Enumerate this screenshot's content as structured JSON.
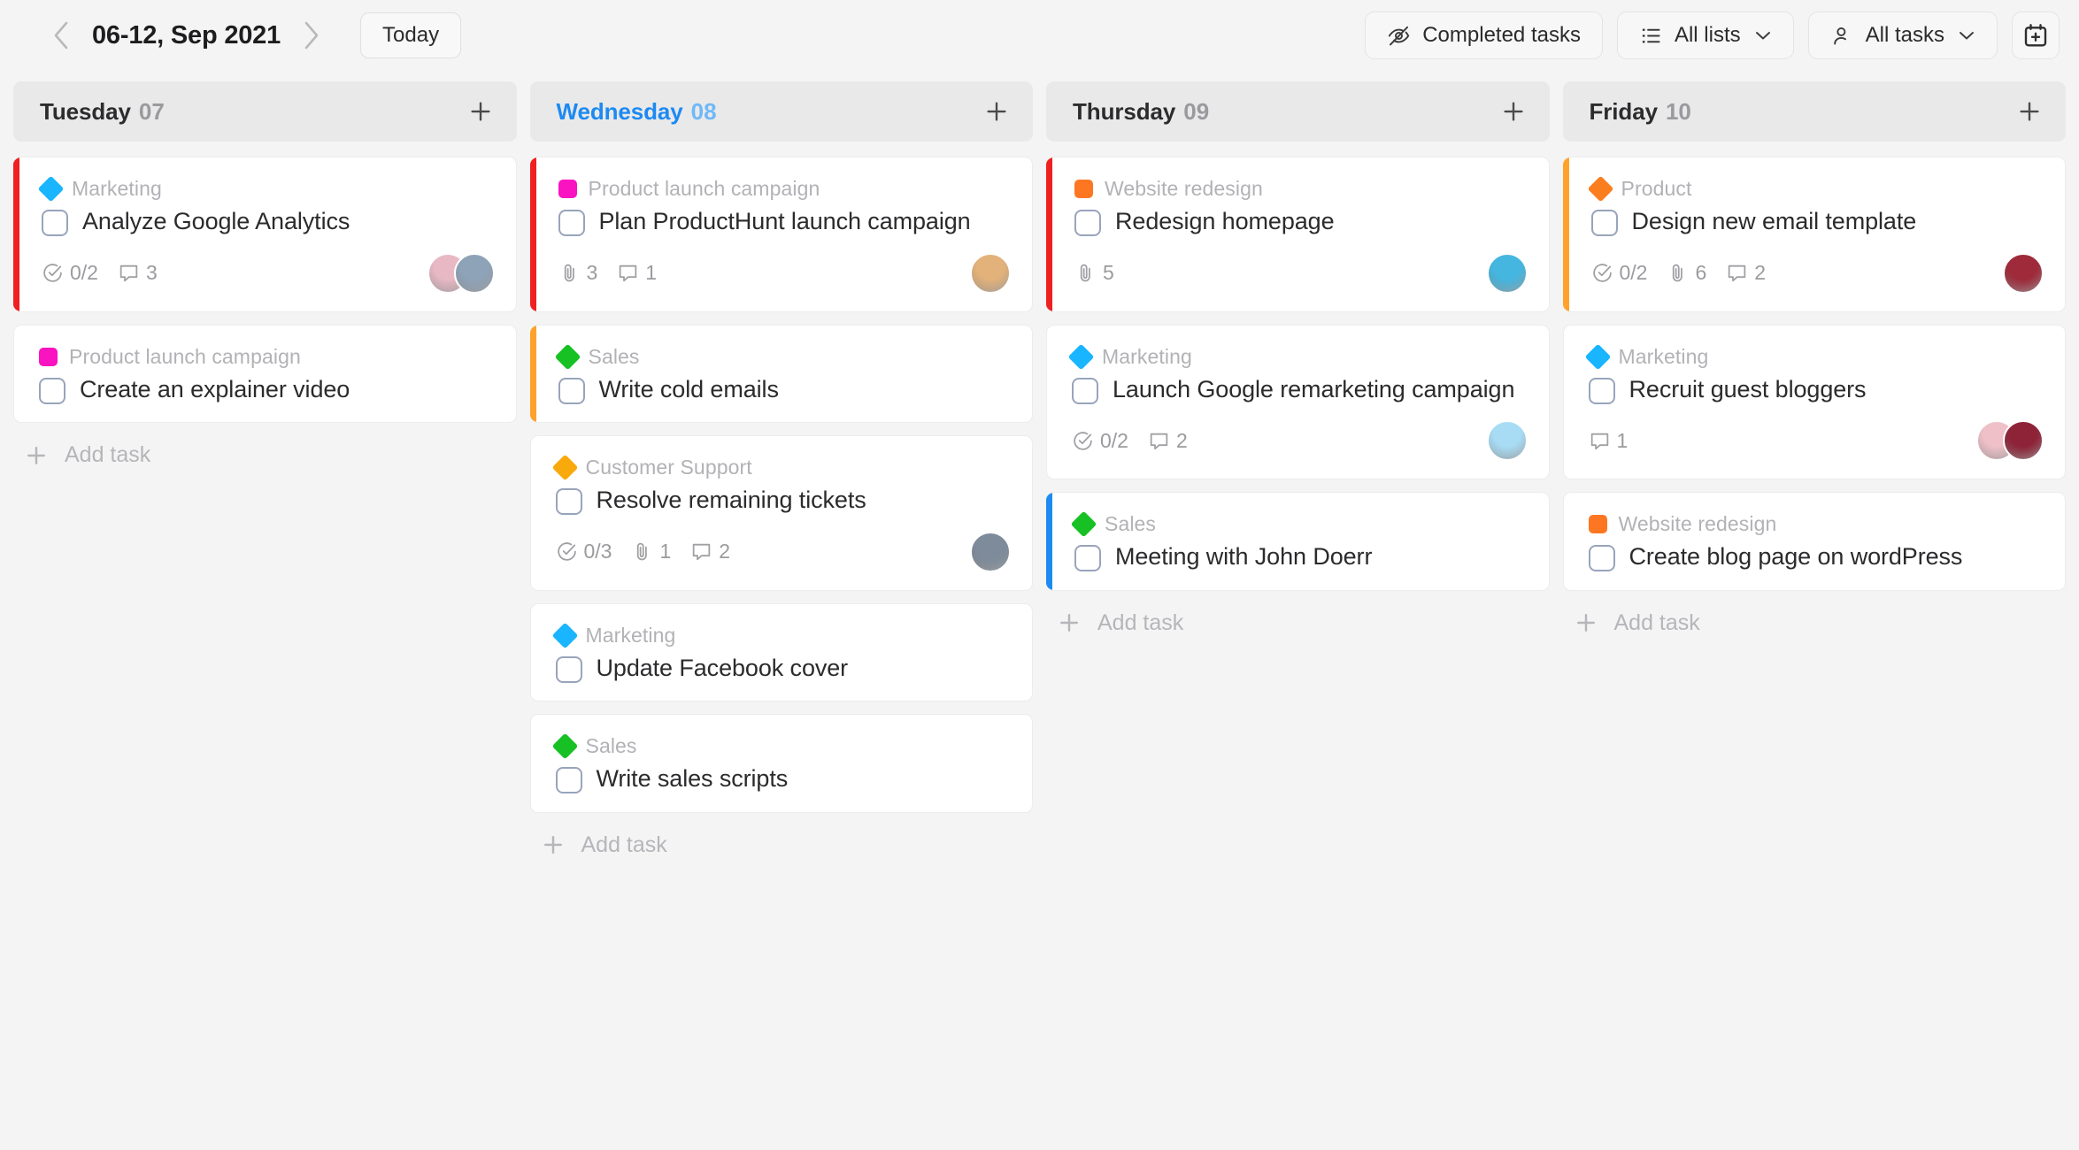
{
  "toolbar": {
    "prev_icon": "chevron-left-icon",
    "next_icon": "chevron-right-icon",
    "date_range": "06-12, Sep 2021",
    "today_label": "Today",
    "completed_tasks_label": "Completed tasks",
    "completed_tasks_icon": "eye-off-icon",
    "all_lists_label": "All lists",
    "all_lists_icon": "list-icon",
    "all_tasks_label": "All tasks",
    "all_tasks_icon": "person-icon",
    "caret_icon": "chevron-down-icon",
    "add_calendar_icon": "calendar-plus-icon"
  },
  "accent_colors": {
    "red": "#f02020",
    "orange": "#ffa22b",
    "blue": "#1d8af2",
    "today_blue": "#1d8af2"
  },
  "tag_colors": {
    "Marketing": "#19b5fe",
    "Product launch campaign": "#fa13c0",
    "Sales": "#17c123",
    "Customer Support": "#f8a90b",
    "Website redesign": "#fd7722",
    "Product": "#fb7e1e"
  },
  "add_task_label": "Add task",
  "add_task_icon": "plus-icon",
  "column_add_icon": "plus-icon",
  "columns": [
    {
      "day": "Tuesday",
      "date": "07",
      "is_today": false,
      "cards": [
        {
          "accent": "#f02020",
          "tag": "Marketing",
          "tag_shape": "diamond",
          "title": "Analyze Google Analytics",
          "meta": [
            {
              "icon": "subtasks-icon",
              "value": "0/2"
            },
            {
              "icon": "comment-icon",
              "value": "3"
            }
          ],
          "avatars": [
            "#e8b9c4",
            "#8fa3b8"
          ]
        },
        {
          "accent": null,
          "tag": "Product launch campaign",
          "tag_shape": "square",
          "title": "Create an explainer video",
          "meta": [],
          "avatars": []
        }
      ]
    },
    {
      "day": "Wednesday",
      "date": "08",
      "is_today": true,
      "cards": [
        {
          "accent": "#f02020",
          "tag": "Product launch campaign",
          "tag_shape": "square",
          "title": "Plan ProductHunt launch campaign",
          "meta": [
            {
              "icon": "attachment-icon",
              "value": "3"
            },
            {
              "icon": "comment-icon",
              "value": "1"
            }
          ],
          "avatars": [
            "#e3b27a"
          ]
        },
        {
          "accent": "#ffa22b",
          "tag": "Sales",
          "tag_shape": "diamond",
          "title": "Write cold emails",
          "meta": [],
          "avatars": []
        },
        {
          "accent": null,
          "tag": "Customer Support",
          "tag_shape": "diamond",
          "title": "Resolve remaining tickets",
          "meta": [
            {
              "icon": "subtasks-icon",
              "value": "0/3"
            },
            {
              "icon": "attachment-icon",
              "value": "1"
            },
            {
              "icon": "comment-icon",
              "value": "2"
            }
          ],
          "avatars": [
            "#7d8b9b"
          ]
        },
        {
          "accent": null,
          "tag": "Marketing",
          "tag_shape": "diamond",
          "title": "Update Facebook cover",
          "meta": [],
          "avatars": []
        },
        {
          "accent": null,
          "tag": "Sales",
          "tag_shape": "diamond",
          "title": "Write sales scripts",
          "meta": [],
          "avatars": []
        }
      ]
    },
    {
      "day": "Thursday",
      "date": "09",
      "is_today": false,
      "cards": [
        {
          "accent": "#f02020",
          "tag": "Website redesign",
          "tag_shape": "square",
          "title": "Redesign homepage",
          "meta": [
            {
              "icon": "attachment-icon",
              "value": "5"
            }
          ],
          "avatars": [
            "#45b6e0"
          ]
        },
        {
          "accent": null,
          "tag": "Marketing",
          "tag_shape": "diamond",
          "title": "Launch Google remarketing campaign",
          "meta": [
            {
              "icon": "subtasks-icon",
              "value": "0/2"
            },
            {
              "icon": "comment-icon",
              "value": "2"
            }
          ],
          "avatars": [
            "#a8dcf5"
          ]
        },
        {
          "accent": "#1d8af2",
          "tag": "Sales",
          "tag_shape": "diamond",
          "title": "Meeting with John Doerr",
          "meta": [],
          "avatars": []
        }
      ]
    },
    {
      "day": "Friday",
      "date": "10",
      "is_today": false,
      "cards": [
        {
          "accent": "#ffa22b",
          "tag": "Product",
          "tag_shape": "diamond",
          "title": "Design new email template",
          "meta": [
            {
              "icon": "subtasks-icon",
              "value": "0/2"
            },
            {
              "icon": "attachment-icon",
              "value": "6"
            },
            {
              "icon": "comment-icon",
              "value": "2"
            }
          ],
          "avatars": [
            "#9e2a3a"
          ]
        },
        {
          "accent": null,
          "tag": "Marketing",
          "tag_shape": "diamond",
          "title": "Recruit guest bloggers",
          "meta": [
            {
              "icon": "comment-icon",
              "value": "1"
            }
          ],
          "avatars": [
            "#efc0c8",
            "#8e2338"
          ]
        },
        {
          "accent": null,
          "tag": "Website redesign",
          "tag_shape": "square",
          "title": "Create blog page on wordPress",
          "meta": [],
          "avatars": []
        }
      ]
    }
  ]
}
